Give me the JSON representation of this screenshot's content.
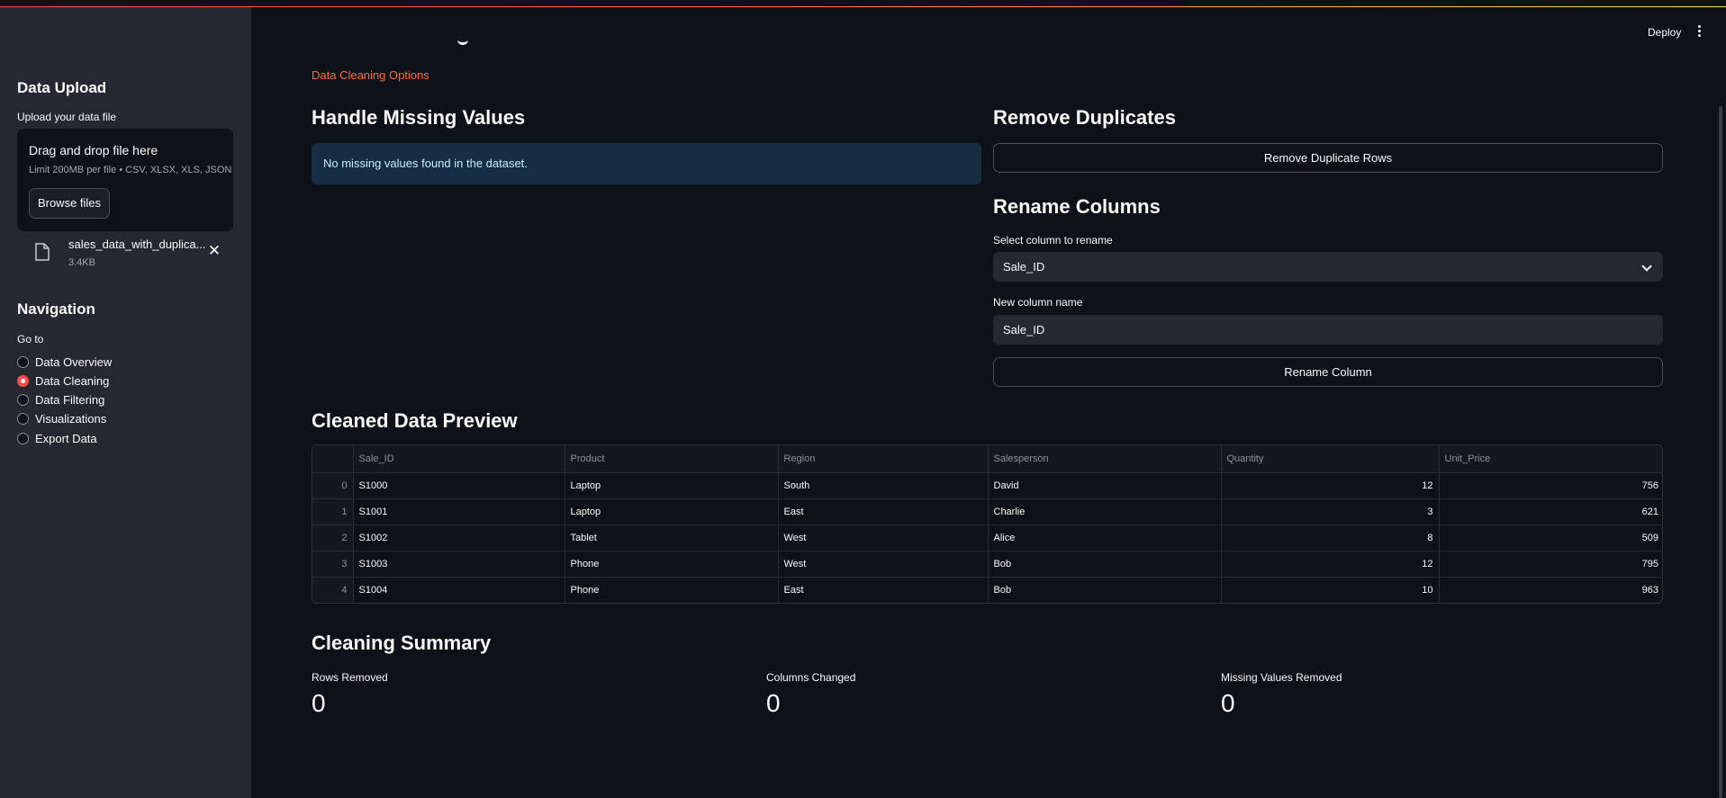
{
  "sidebar": {
    "upload_heading": "Data Upload",
    "upload_label": "Upload your data file",
    "dropzone_title": "Drag and drop file here",
    "dropzone_limit": "Limit 200MB per file • CSV, XLSX, XLS, JSON",
    "browse_label": "Browse files",
    "file": {
      "name": "sales_data_with_duplica...",
      "size": "3.4KB"
    },
    "nav_heading": "Navigation",
    "nav_label": "Go to",
    "nav_items": [
      {
        "label": "Data Overview",
        "selected": false
      },
      {
        "label": "Data Cleaning",
        "selected": true
      },
      {
        "label": "Data Filtering",
        "selected": false
      },
      {
        "label": "Visualizations",
        "selected": false
      },
      {
        "label": "Export Data",
        "selected": false
      }
    ]
  },
  "header": {
    "deploy_label": "Deploy"
  },
  "main": {
    "options_label": "Data Cleaning Options",
    "missing": {
      "heading": "Handle Missing Values",
      "info": "No missing values found in the dataset."
    },
    "duplicates": {
      "heading": "Remove Duplicates",
      "button": "Remove Duplicate Rows"
    },
    "rename": {
      "heading": "Rename Columns",
      "select_label": "Select column to rename",
      "select_value": "Sale_ID",
      "input_label": "New column name",
      "input_value": "Sale_ID",
      "button": "Rename Column"
    },
    "preview": {
      "heading": "Cleaned Data Preview",
      "columns": [
        "Sale_ID",
        "Product",
        "Region",
        "Salesperson",
        "Quantity",
        "Unit_Price"
      ],
      "rows": [
        {
          "index": "0",
          "cells": [
            "S1000",
            "Laptop",
            "South",
            "David",
            "12",
            "756"
          ]
        },
        {
          "index": "1",
          "cells": [
            "S1001",
            "Laptop",
            "East",
            "Charlie",
            "3",
            "621"
          ]
        },
        {
          "index": "2",
          "cells": [
            "S1002",
            "Tablet",
            "West",
            "Alice",
            "8",
            "509"
          ]
        },
        {
          "index": "3",
          "cells": [
            "S1003",
            "Phone",
            "West",
            "Bob",
            "12",
            "795"
          ]
        },
        {
          "index": "4",
          "cells": [
            "S1004",
            "Phone",
            "East",
            "Bob",
            "10",
            "963"
          ]
        }
      ]
    },
    "summary": {
      "heading": "Cleaning Summary",
      "metrics": [
        {
          "label": "Rows Removed",
          "value": "0"
        },
        {
          "label": "Columns Changed",
          "value": "0"
        },
        {
          "label": "Missing Values Removed",
          "value": "0"
        }
      ]
    }
  },
  "colors": {
    "accent": "#ff4b4b",
    "link": "#ff6b3d",
    "info_bg": "#172d43",
    "sidebar_bg": "#262730",
    "app_bg": "#0e1117"
  }
}
